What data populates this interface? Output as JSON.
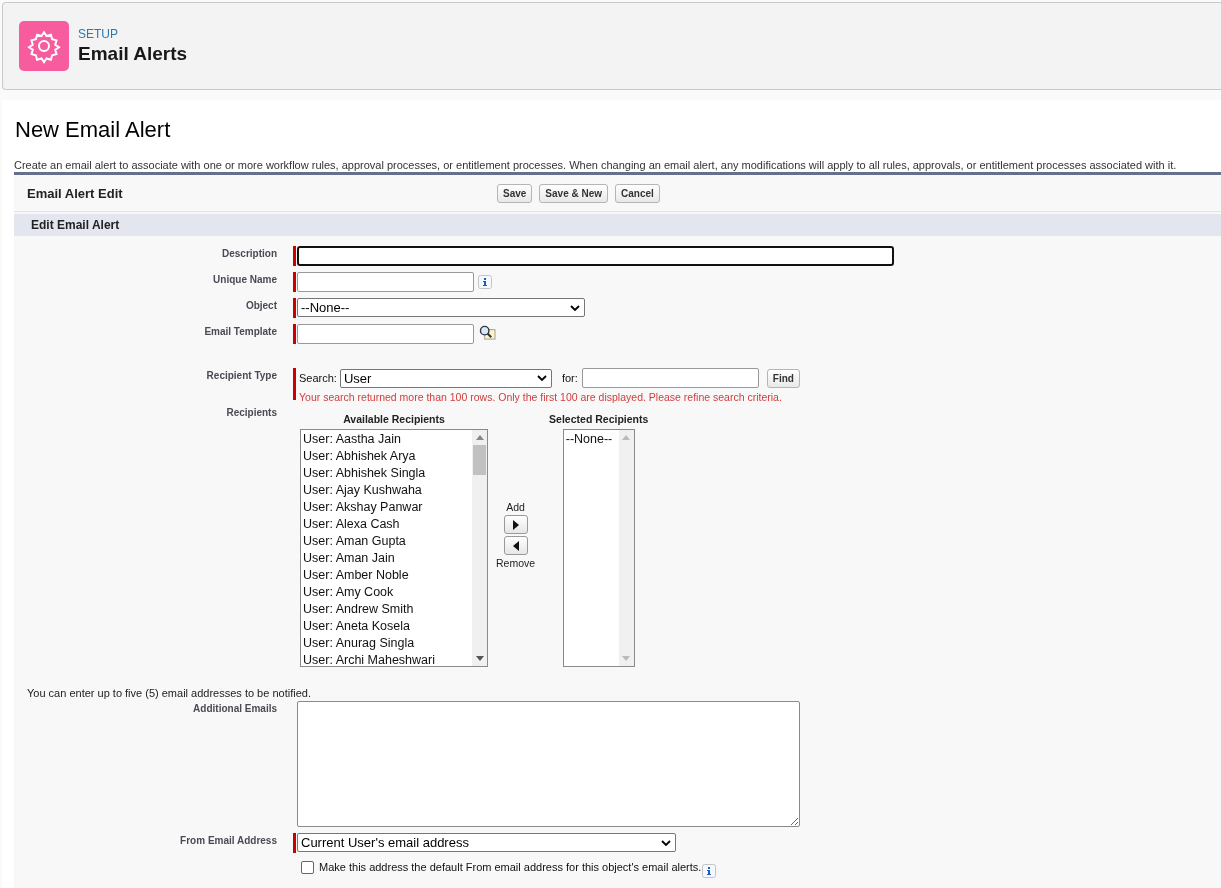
{
  "header": {
    "eyebrow": "SETUP",
    "title": "Email Alerts"
  },
  "page": {
    "title": "New Email Alert",
    "description": "Create an email alert to associate with one or more workflow rules, approval processes, or entitlement processes. When changing an email alert, any modifications will apply to all rules, approvals, or entitlement processes associated with it."
  },
  "form": {
    "title": "Email Alert Edit",
    "buttons": [
      "Save",
      "Save & New",
      "Cancel"
    ],
    "section": "Edit Email Alert",
    "fields": [
      {
        "kind": "focused_text",
        "label": "Description",
        "required": true
      },
      {
        "kind": "info_text",
        "label": "Unique Name",
        "required": true
      },
      {
        "kind": "select",
        "label": "Object",
        "required": true,
        "value": "--None--"
      },
      {
        "kind": "lookup_text",
        "label": "Email Template",
        "required": true
      }
    ],
    "recipient_type": {
      "label": "Recipient Type",
      "search_label": "Search:",
      "search_value": "User",
      "for_label": "for:",
      "button": "Find",
      "error": "Your search returned more than 100 rows. Only the first 100 are displayed. Please refine search criteria."
    },
    "recipients": {
      "label": "Recipients",
      "available_title": "Available Recipients",
      "selected_title": "Selected Recipients",
      "add_label": "Add",
      "remove_label": "Remove",
      "available": [
        "User: Aastha Jain",
        "User: Abhishek Arya",
        "User: Abhishek Singla",
        "User: Ajay Kushwaha",
        "User: Akshay Panwar",
        "User: Alexa Cash",
        "User: Aman Gupta",
        "User: Aman Jain",
        "User: Amber Noble",
        "User: Amy Cook",
        "User: Andrew Smith",
        "User: Aneta Kosela",
        "User: Anurag Singla",
        "User: Archi Maheshwari"
      ],
      "selected": [
        "--None--"
      ]
    },
    "emails_note": "You can enter up to five (5) email addresses to be notified.",
    "additional_emails": {
      "label": "Additional Emails"
    },
    "from_email": {
      "label": "From Email Address",
      "value": "Current User's email address"
    },
    "default_checkbox": {
      "label": "Make this address the default From email address for this object's email alerts.",
      "checked": false
    }
  }
}
